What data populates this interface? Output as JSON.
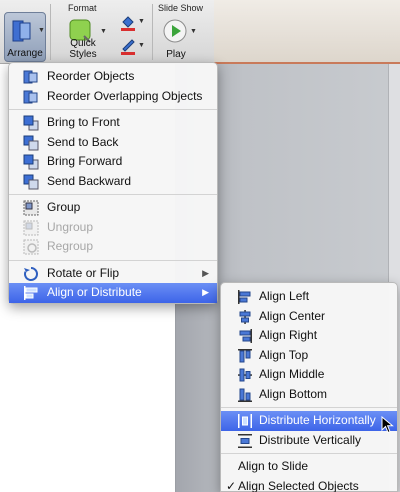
{
  "ribbon": {
    "groups": {
      "format": "Format",
      "slide_show": "Slide Show"
    },
    "arrange_label": "Arrange",
    "quick_styles_label": "Quick Styles",
    "play_label": "Play"
  },
  "menu": {
    "items": [
      {
        "label": "Reorder Objects"
      },
      {
        "label": "Reorder Overlapping Objects"
      },
      {
        "label": "Bring to Front"
      },
      {
        "label": "Send to Back"
      },
      {
        "label": "Bring Forward"
      },
      {
        "label": "Send Backward"
      },
      {
        "label": "Group"
      },
      {
        "label": "Ungroup"
      },
      {
        "label": "Regroup"
      },
      {
        "label": "Rotate or Flip"
      },
      {
        "label": "Align or Distribute"
      }
    ]
  },
  "submenu": {
    "items": [
      {
        "label": "Align Left"
      },
      {
        "label": "Align Center"
      },
      {
        "label": "Align Right"
      },
      {
        "label": "Align Top"
      },
      {
        "label": "Align Middle"
      },
      {
        "label": "Align Bottom"
      },
      {
        "label": "Distribute Horizontally"
      },
      {
        "label": "Distribute Vertically"
      },
      {
        "label": "Align to Slide"
      },
      {
        "label": "Align Selected Objects"
      }
    ],
    "check_mark": "✓"
  }
}
